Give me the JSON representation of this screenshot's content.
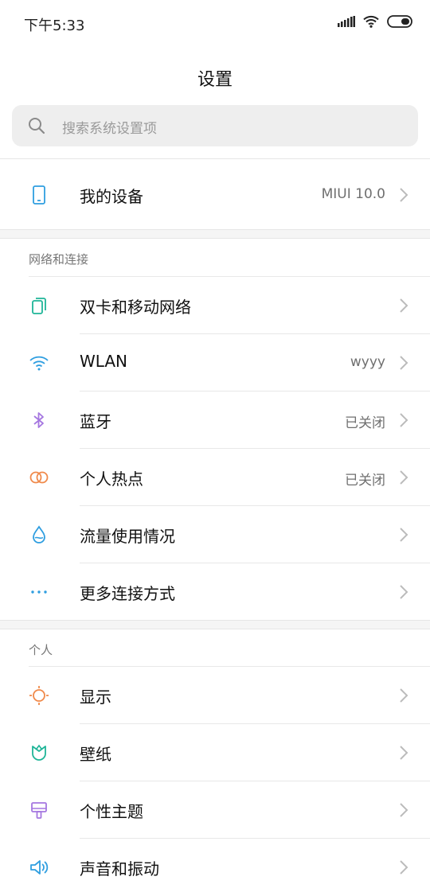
{
  "status_bar": {
    "time": "下午5:33",
    "icons": [
      "signal-icon",
      "wifi-icon",
      "battery-icon"
    ]
  },
  "header": {
    "title": "设置"
  },
  "search": {
    "placeholder": "搜索系统设置项"
  },
  "my_device": {
    "label": "我的设备",
    "value": "MIUI 10.0",
    "icon": "phone-icon",
    "color": "#2f9ee0"
  },
  "sections": [
    {
      "title": "网络和连接",
      "items": [
        {
          "label": "双卡和移动网络",
          "value": "",
          "icon": "dual-sim-icon",
          "color": "#1fb598"
        },
        {
          "label": "WLAN",
          "value": "wyyy",
          "icon": "wifi-icon",
          "color": "#2f9ee0"
        },
        {
          "label": "蓝牙",
          "value": "已关闭",
          "icon": "bluetooth-icon",
          "color": "#a577e0"
        },
        {
          "label": "个人热点",
          "value": "已关闭",
          "icon": "hotspot-icon",
          "color": "#f08a4b"
        },
        {
          "label": "流量使用情况",
          "value": "",
          "icon": "data-usage-icon",
          "color": "#2f9ee0"
        },
        {
          "label": "更多连接方式",
          "value": "",
          "icon": "more-icon",
          "color": "#2f9ee0"
        }
      ]
    },
    {
      "title": "个人",
      "items": [
        {
          "label": "显示",
          "value": "",
          "icon": "display-icon",
          "color": "#f08a4b"
        },
        {
          "label": "壁纸",
          "value": "",
          "icon": "wallpaper-icon",
          "color": "#1fb598"
        },
        {
          "label": "个性主题",
          "value": "",
          "icon": "theme-icon",
          "color": "#a577e0"
        },
        {
          "label": "声音和振动",
          "value": "",
          "icon": "sound-icon",
          "color": "#2f9ee0"
        }
      ]
    }
  ]
}
